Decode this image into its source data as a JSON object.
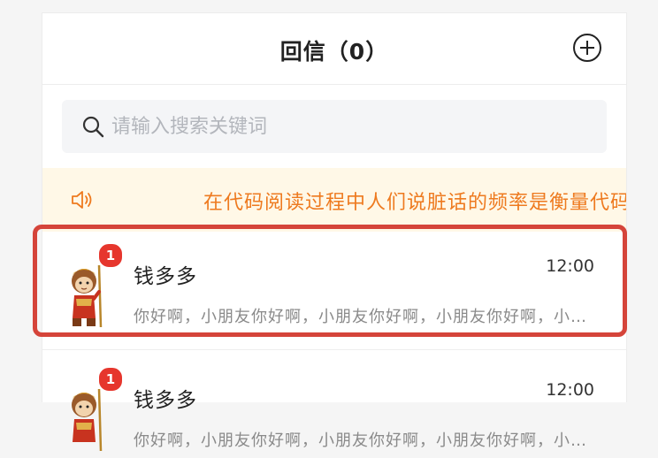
{
  "header": {
    "title": "回信（0）",
    "add_icon": "plus-circle-icon"
  },
  "search": {
    "placeholder": "请输入搜索关键词",
    "icon": "search-icon"
  },
  "notice": {
    "icon": "speaker-icon",
    "text": "在代码阅读过程中人们说脏话的频率是衡量代码质量的唯一标准",
    "color": "#ee7a1f"
  },
  "messages": [
    {
      "name": "钱多多",
      "time": "12:00",
      "preview": "你好啊，小朋友你好啊，小朋友你好啊，小朋友你好啊，小朋友你好啊",
      "unread": "1",
      "avatar": "monkey-king-avatar"
    },
    {
      "name": "钱多多",
      "time": "12:00",
      "preview": "你好啊，小朋友你好啊，小朋友你好啊，小朋友你好啊，小朋友你好啊",
      "unread": "1",
      "avatar": "monkey-king-avatar"
    }
  ],
  "colors": {
    "badge": "#e6362d",
    "highlight": "#d5443a",
    "notice_bg": "#fff8e7"
  }
}
